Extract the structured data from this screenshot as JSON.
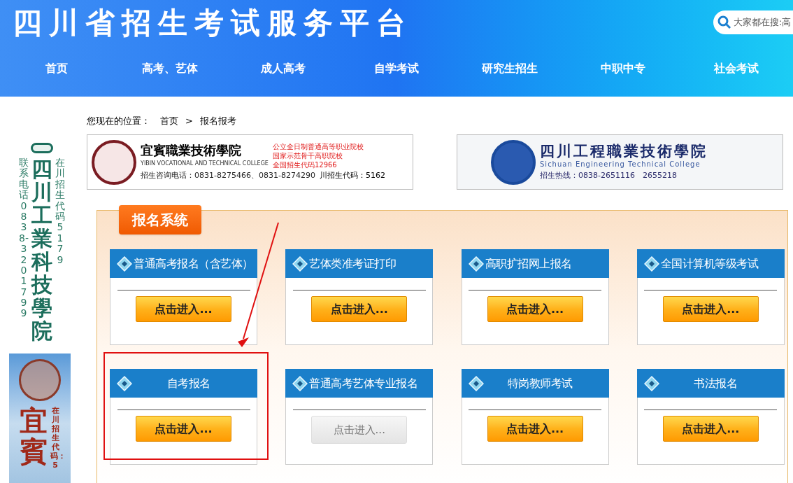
{
  "header": {
    "site_title": "四川省招生考试服务平台",
    "search_placeholder": "大家都在搜:高"
  },
  "nav": [
    {
      "label": "首页"
    },
    {
      "label": "高考、艺体"
    },
    {
      "label": "成人高考"
    },
    {
      "label": "自学考试"
    },
    {
      "label": "研究生招生"
    },
    {
      "label": "中职中专"
    },
    {
      "label": "社会考试"
    }
  ],
  "breadcrumb": {
    "prefix": "您现在的位置：",
    "items": [
      "首页",
      "报名报考"
    ],
    "separator": ">"
  },
  "side_ads": [
    {
      "kind": "green",
      "columns": [
        "联系电话0838-3201799",
        "四川工業科技學院",
        "在川招生代码5179"
      ]
    },
    {
      "kind": "photo",
      "columns": [
        "宜賓",
        "在川招生代码：5"
      ]
    }
  ],
  "banners": [
    {
      "kind": "red",
      "name_cn": "宜賓職業技術學院",
      "name_en": "YIBIN VOCATIONAL AND TECHNICAL COLLEGE",
      "notes": [
        "公立全日制普通高等职业院校",
        "国家示范骨干高职院校",
        "全国招生代码12966"
      ],
      "contact": "招生咨询电话：0831-8275466、0831-8274290",
      "code": "川招生代码：5162"
    },
    {
      "kind": "blue",
      "name_cn": "四川工程職業技術學院",
      "name_en": "Sichuan Engineering Technical College",
      "contact": "招生热线：0838-2651116　2655218"
    }
  ],
  "panel": {
    "title": "报名系统",
    "cards": [
      {
        "title": "普通高考报名（含艺体）",
        "button": "点击进入...",
        "disabled": false,
        "highlighted": false
      },
      {
        "title": "艺体类准考证打印",
        "button": "点击进入...",
        "disabled": false,
        "highlighted": false
      },
      {
        "title": "高职扩招网上报名",
        "button": "点击进入...",
        "disabled": false,
        "highlighted": false
      },
      {
        "title": "全国计算机等级考试",
        "button": "点击进入...",
        "disabled": false,
        "highlighted": false
      },
      {
        "title": "自考报名",
        "button": "点击进入...",
        "disabled": false,
        "highlighted": true
      },
      {
        "title": "普通高考艺体专业报名",
        "button": "点击进入...",
        "disabled": true,
        "highlighted": false
      },
      {
        "title": "特岗教师考试",
        "button": "点击进入...",
        "disabled": false,
        "highlighted": false
      },
      {
        "title": "书法报名",
        "button": "点击进入...",
        "disabled": false,
        "highlighted": false
      }
    ]
  }
}
